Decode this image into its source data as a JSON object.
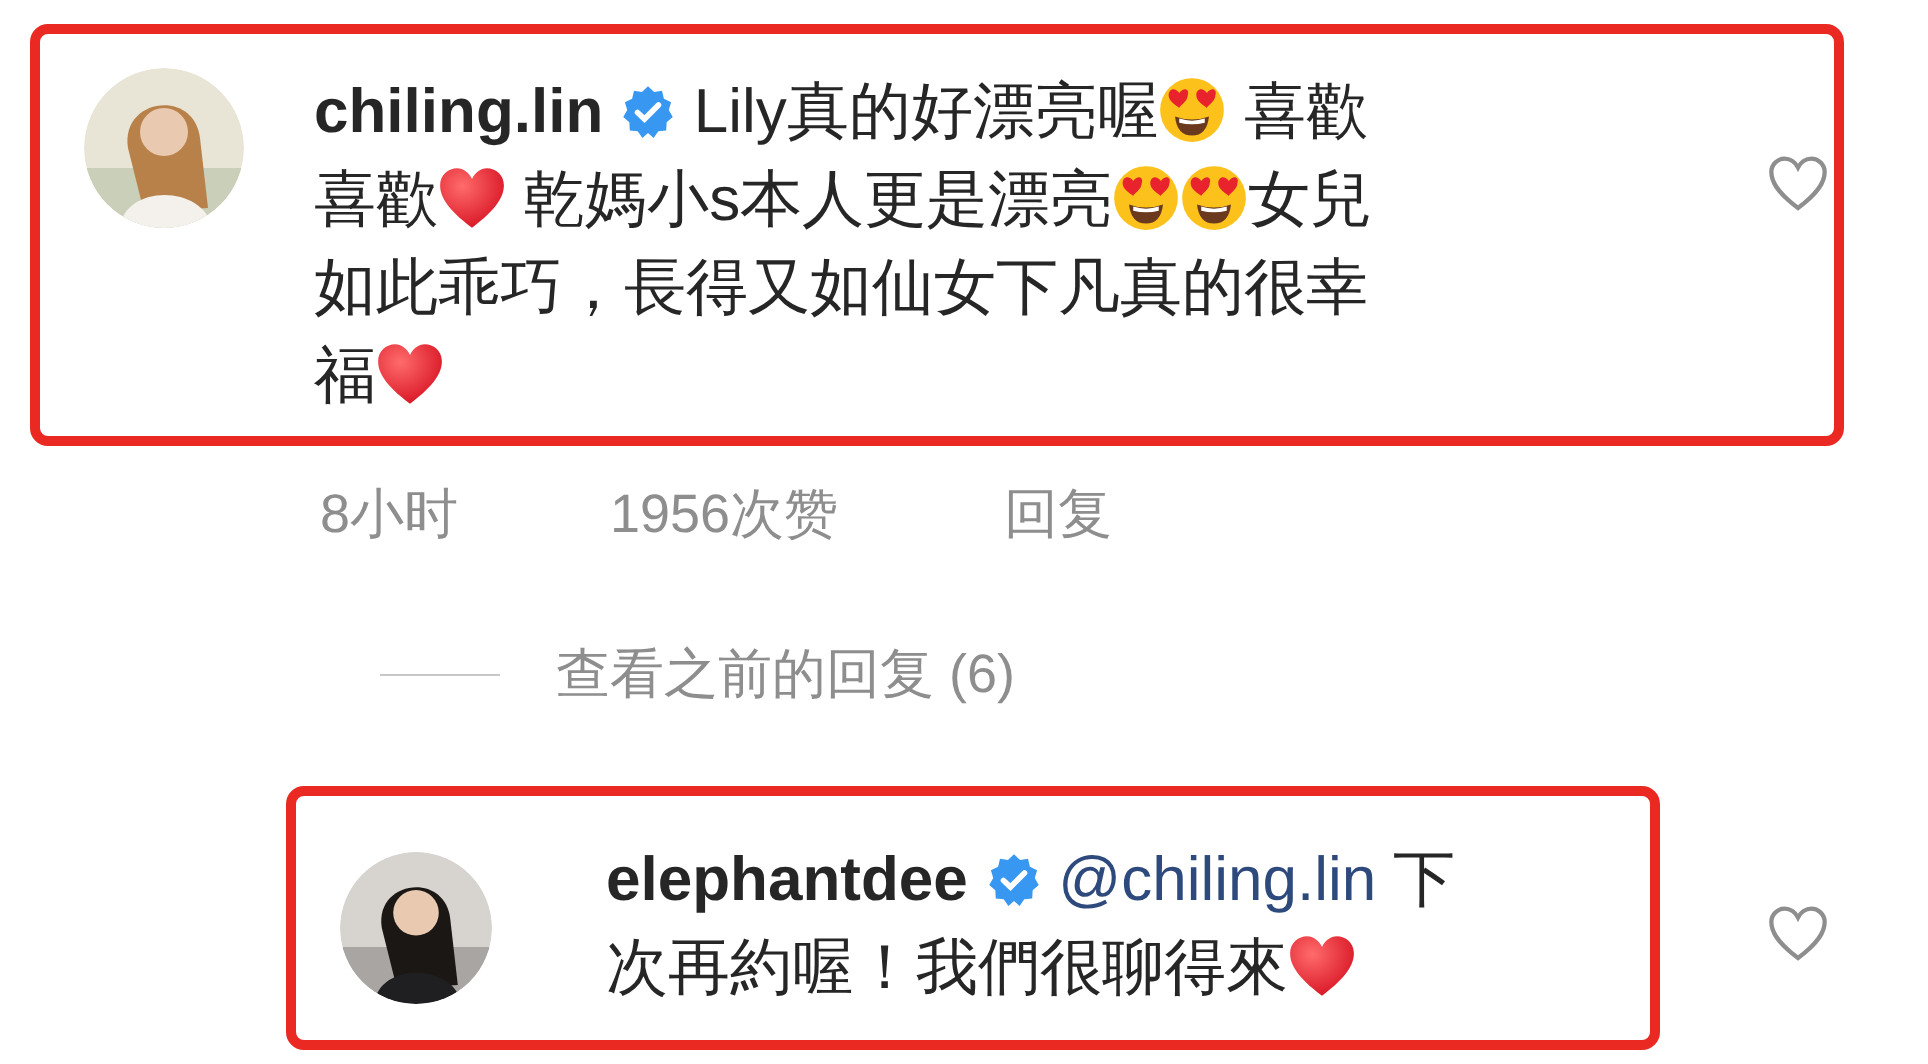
{
  "comments": [
    {
      "username": "chiling.lin",
      "verified": true,
      "highlighted": true,
      "liked": false,
      "avatar": {
        "kind": "picture"
      },
      "lines": [
        [
          {
            "kind": "text",
            "text": "Lily真的好漂亮喔"
          },
          {
            "kind": "heart_eyes"
          },
          {
            "kind": "text",
            "text": " 喜歡"
          }
        ],
        [
          {
            "kind": "text",
            "text": "喜歡"
          },
          {
            "kind": "heart"
          },
          {
            "kind": "text",
            "text": " 乾媽小s本人更是漂亮"
          },
          {
            "kind": "heart_eyes"
          },
          {
            "kind": "heart_eyes"
          },
          {
            "kind": "text",
            "text": "女兒"
          }
        ],
        [
          {
            "kind": "text",
            "text": "如此乖巧，長得又如仙女下凡真的很幸"
          }
        ],
        [
          {
            "kind": "text",
            "text": "福"
          },
          {
            "kind": "heart"
          }
        ]
      ],
      "meta": {
        "time": "8小时",
        "likes": "1956次赞",
        "reply": "回复"
      }
    },
    {
      "username": "elephantdee",
      "verified": true,
      "highlighted": true,
      "liked": false,
      "avatar": {
        "kind": "picture"
      },
      "lines": [
        [
          {
            "kind": "mention",
            "text": "@chiling.lin"
          },
          {
            "kind": "text",
            "text": " 下"
          }
        ],
        [
          {
            "kind": "text",
            "text": "次再約喔！我們很聊得來"
          },
          {
            "kind": "heart"
          }
        ]
      ]
    }
  ],
  "view_replies": {
    "label": "查看之前的回复 (6)"
  }
}
